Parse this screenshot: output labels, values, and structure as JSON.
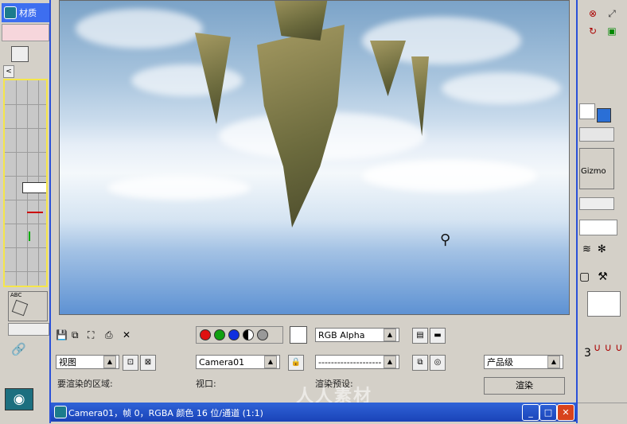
{
  "left_panel": {
    "app_title": "材质",
    "viewport_label": "[ ⊥ ⊿ ⊿ ]",
    "tool_label": "ABC"
  },
  "right_panel": {
    "gizmo_label": "Gizmo",
    "frame_number": "3"
  },
  "render_window": {
    "toolbar": {
      "channel_dropdown": "RGB Alpha"
    },
    "area_dropdown": "视图",
    "viewport_dropdown": "Camera01",
    "preset_dropdown": "--------------------",
    "renderer_dropdown": "产品级",
    "area_label": "要渲染的区域:",
    "viewport_label": "视口:",
    "preset_label": "渲染预设:",
    "render_button": "渲染",
    "title": "Camera01，帧 0，RGBA 颜色 16 位/通道 (1:1)",
    "watermark": "人人素材"
  },
  "colors": {
    "titlebar": "#2f63d8",
    "accent_blue": "#2a6fd6"
  }
}
